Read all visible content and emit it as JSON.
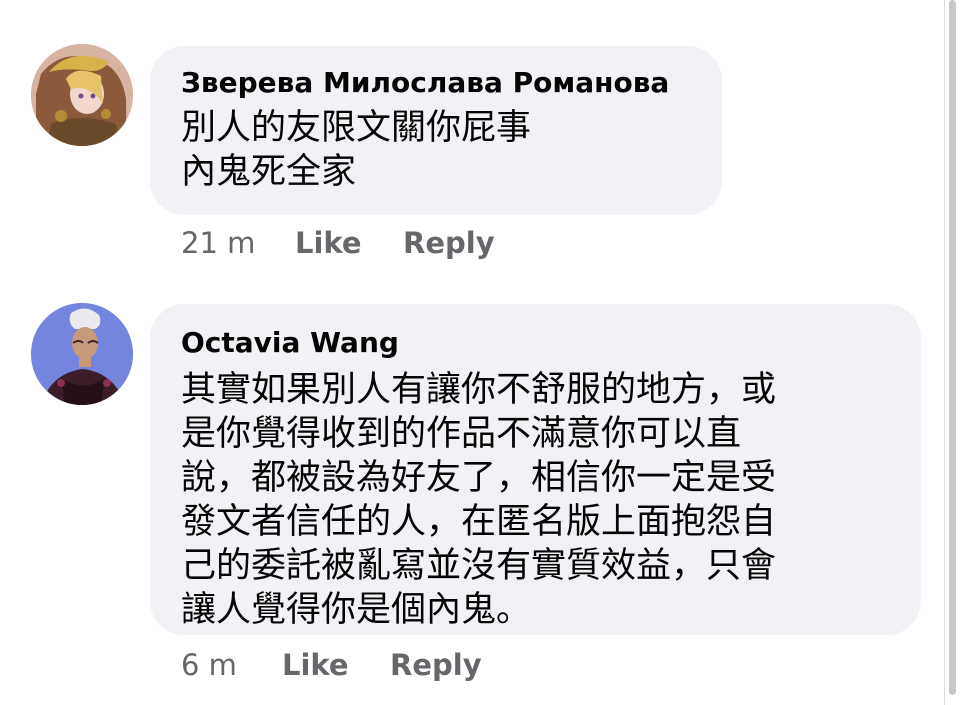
{
  "comments": [
    {
      "author": "Зверева Милослава Романова",
      "text_lines": [
        "別人的友限文關你屁事",
        "內鬼死全家"
      ],
      "time": "21 m",
      "like_label": "Like",
      "reply_label": "Reply"
    },
    {
      "author": "Octavia Wang",
      "text_lines": [
        "其實如果別人有讓你不舒服的地方，或",
        "是你覺得收到的作品不滿意你可以直",
        "說，都被設為好友了，相信你一定是受",
        "發文者信任的人，在匿名版上面抱怨自",
        "己的委託被亂寫並沒有實質效益，只會",
        "讓人覺得你是個內鬼。"
      ],
      "time": "6 m",
      "like_label": "Like",
      "reply_label": "Reply"
    }
  ],
  "colors": {
    "bubble": "#f0f2f5",
    "text": "#050505",
    "meta": "#65676b"
  }
}
